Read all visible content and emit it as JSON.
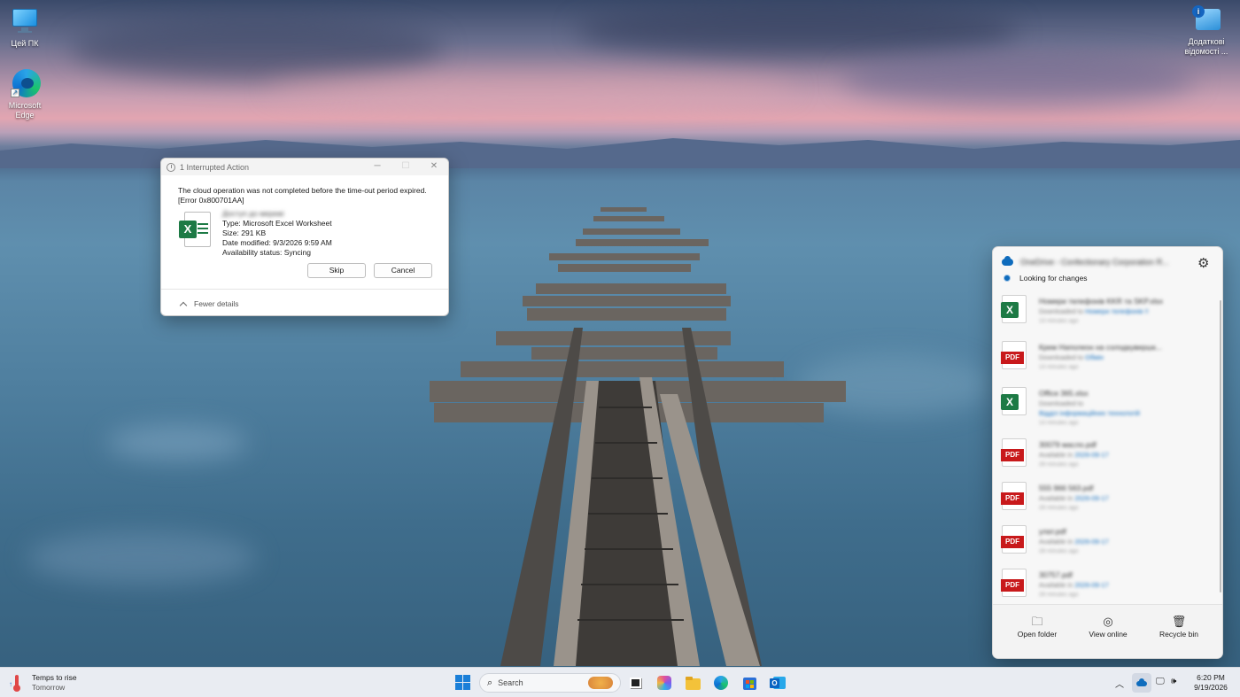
{
  "desktop": {
    "icons": [
      {
        "label": "Цей ПК"
      },
      {
        "label": "Microsoft Edge"
      },
      {
        "label": "Додаткові відомості ..."
      }
    ]
  },
  "dialog": {
    "title": "1 Interrupted Action",
    "message": "The cloud operation was not completed before the time-out period expired. [Error 0x800701AA]",
    "file_name": "Доступ до мережі",
    "type": "Type: Microsoft Excel Worksheet",
    "size": "Size: 291 KB",
    "date_modified": "Date modified: 9/3/2026 9:59 AM",
    "availability": "Availability status: Syncing",
    "skip_label": "Skip",
    "cancel_label": "Cancel",
    "fewer_details_label": "Fewer details"
  },
  "onedrive": {
    "title": "OneDrive - Confectionary Corporation R...",
    "status": "Looking for changes",
    "items": [
      {
        "type": "xlsx",
        "name": "Номери телефонів KKR та SKP.xlsx",
        "sub_prefix": "Downloaded to",
        "sub_link": "Номери телефонів !!",
        "time": "13 minutes ago"
      },
      {
        "type": "pdf",
        "name": "Крем Наполеон на солодкувершк...",
        "sub_prefix": "Downloaded to",
        "sub_link": "Обмін",
        "time": "13 minutes ago"
      },
      {
        "type": "xlsx",
        "name": "Office 365.xlsx",
        "sub_prefix": "Downloaded to",
        "sub_link": "Відділ інформаційних технологій",
        "time": "13 minutes ago"
      },
      {
        "type": "pdf",
        "name": "30079 масло.pdf",
        "sub_prefix": "Available in",
        "sub_link": "2026-09-17",
        "time": "28 minutes ago"
      },
      {
        "type": "pdf",
        "name": "555 966 563.pdf",
        "sub_prefix": "Available in",
        "sub_link": "2026-09-17",
        "time": "28 minutes ago"
      },
      {
        "type": "pdf",
        "name": "улат.pdf",
        "sub_prefix": "Available in",
        "sub_link": "2026-09-17",
        "time": "28 minutes ago"
      },
      {
        "type": "pdf",
        "name": "30757.pdf",
        "sub_prefix": "Available in",
        "sub_link": "2026-09-17",
        "time": "28 minutes ago"
      }
    ],
    "actions": {
      "open_folder": "Open folder",
      "view_online": "View online",
      "recycle_bin": "Recycle bin"
    }
  },
  "taskbar": {
    "weather_title": "Temps to rise",
    "weather_sub": "Tomorrow",
    "search_placeholder": "Search",
    "time": "6:20 PM",
    "date": "9/19/2026"
  },
  "colors": {
    "accent": "#0f6cbd",
    "excel_green": "#1d7a45",
    "pdf_red": "#c8191b"
  }
}
